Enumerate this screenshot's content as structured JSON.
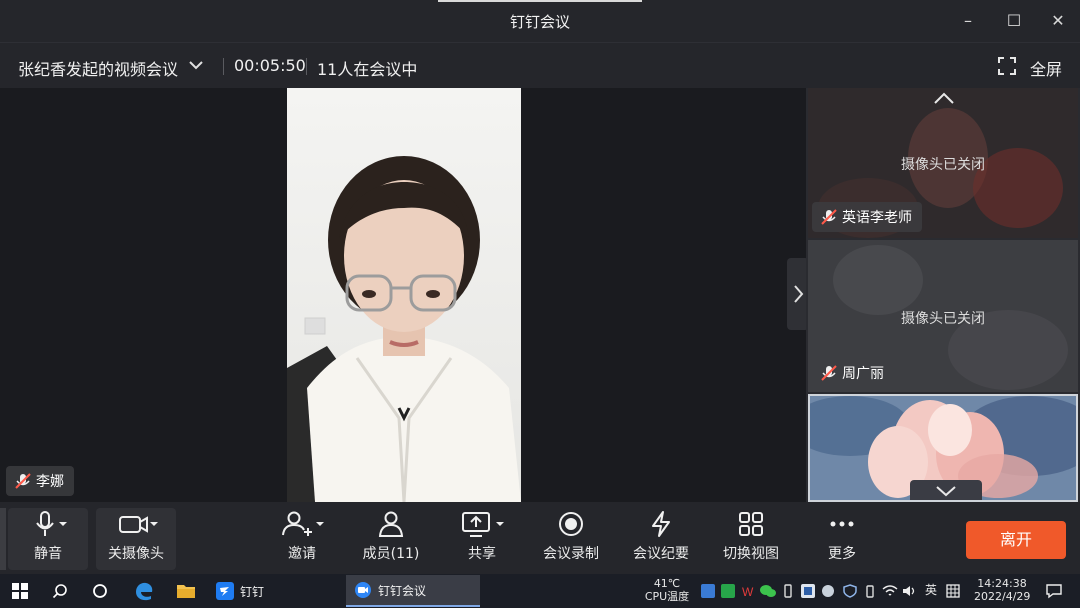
{
  "window": {
    "title": "钉钉会议",
    "minimize": "–",
    "maximize": "☐",
    "close": "✕"
  },
  "infobar": {
    "meeting_title": "张纪香发起的视频会议",
    "elapsed": "00:05:50",
    "participants_text": "11人在会议中",
    "fullscreen_label": "全屏"
  },
  "main_video": {
    "speaker_name": "李娜"
  },
  "side_tiles": [
    {
      "status": "摄像头已关闭",
      "name": "英语李老师"
    },
    {
      "status": "摄像头已关闭",
      "name": "周广丽"
    },
    {
      "status": "",
      "name": ""
    }
  ],
  "toolbar": {
    "mute": "静音",
    "camera_off": "关摄像头",
    "invite": "邀请",
    "members": "成员(11)",
    "share": "共享",
    "record": "会议录制",
    "minutes": "会议纪要",
    "switch_view": "切换视图",
    "more": "更多",
    "leave": "离开"
  },
  "taskbar": {
    "apps": [
      {
        "label": "钉钉",
        "active": false
      },
      {
        "label": "钉钉会议",
        "active": true
      }
    ],
    "cpu_temp_value": "41℃",
    "cpu_temp_label": "CPU温度",
    "ime": "英",
    "time": "14:24:38",
    "date": "2022/4/29"
  },
  "colors": {
    "leave_button": "#f0592a",
    "titlebar_bg": "#25262b",
    "stage_bg": "#1a1b1f"
  }
}
